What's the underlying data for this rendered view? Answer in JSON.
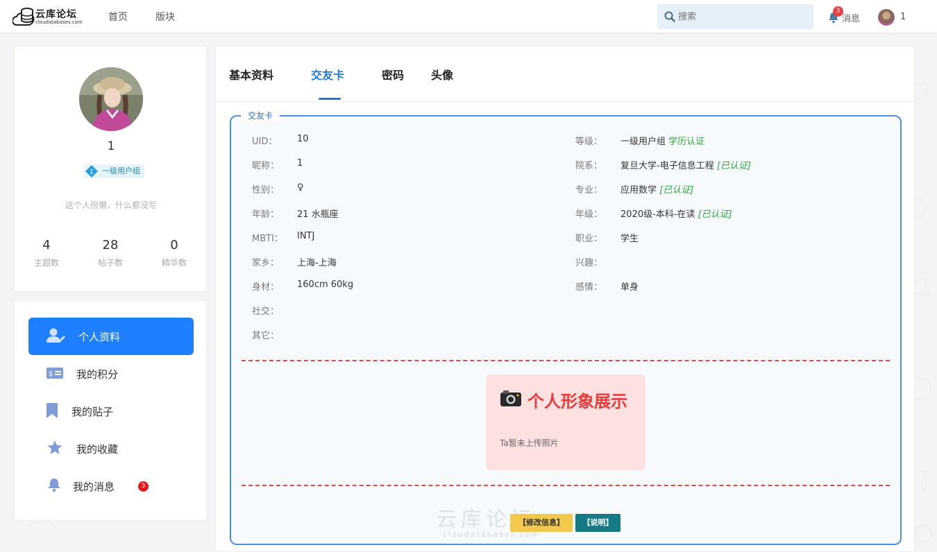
{
  "header": {
    "logo_title": "云库论坛",
    "logo_sub": "cloudatabases.com",
    "nav": [
      "首页",
      "版块"
    ],
    "search_placeholder": "搜索",
    "message_label": "消息",
    "message_count": "3",
    "username": "1"
  },
  "profile": {
    "name": "1",
    "level": "1",
    "group": "一级用户组",
    "bio": "这个人很懒，什么都没写",
    "stats": [
      {
        "num": "4",
        "label": "主题数"
      },
      {
        "num": "28",
        "label": "帖子数"
      },
      {
        "num": "0",
        "label": "精华数"
      }
    ]
  },
  "menu": {
    "items": [
      {
        "label": "个人资料",
        "icon": "user-edit-icon"
      },
      {
        "label": "我的积分",
        "icon": "points-card-icon"
      },
      {
        "label": "我的贴子",
        "icon": "bookmark-icon"
      },
      {
        "label": "我的收藏",
        "icon": "star-icon"
      },
      {
        "label": "我的消息",
        "icon": "bell-icon"
      }
    ],
    "message_badge": "3"
  },
  "tabs": [
    "基本资料",
    "交友卡",
    "密码",
    "头像"
  ],
  "card": {
    "legend": "交友卡",
    "left": [
      {
        "label": "UID：",
        "value": "10"
      },
      {
        "label": "昵称：",
        "value": "1"
      },
      {
        "label": "性别：",
        "value": "♀"
      },
      {
        "label": "年龄：",
        "value": "21 水瓶座"
      },
      {
        "label": "MBTI：",
        "value": "INTJ"
      },
      {
        "label": "家乡：",
        "value": "上海-上海"
      },
      {
        "label": "身材：",
        "value": "160cm 60kg"
      },
      {
        "label": "社交：",
        "value": ""
      },
      {
        "label": "其它：",
        "value": ""
      }
    ],
    "right": [
      {
        "label": "等级：",
        "value": "一级用户组",
        "extra": "学历认证"
      },
      {
        "label": "院系：",
        "value": "复旦大学-电子信息工程",
        "verified": "[已认证]"
      },
      {
        "label": "专业：",
        "value": "应用数学",
        "verified": "[已认证]"
      },
      {
        "label": "年级：",
        "value": "2020级-本科-在读",
        "verified": "[已认证]"
      },
      {
        "label": "职业：",
        "value": "学生"
      },
      {
        "label": "兴趣：",
        "value": ""
      },
      {
        "label": "感情：",
        "value": "单身"
      }
    ],
    "photo_title": "个人形象展示",
    "photo_note": "Ta暂未上传照片",
    "edit_button": "【修改信息】",
    "help_button": "【说明】",
    "watermark": "云库论坛",
    "watermark_sub": "cloudatabases.com"
  },
  "colors": {
    "accent": "#1e80ff",
    "tab_active": "#1e7ad6",
    "verified": "#2aa836",
    "photo_title": "#e53b3b",
    "dash": "#e04848",
    "edit_btn": "#f2c94c",
    "help_btn": "#167a86"
  }
}
